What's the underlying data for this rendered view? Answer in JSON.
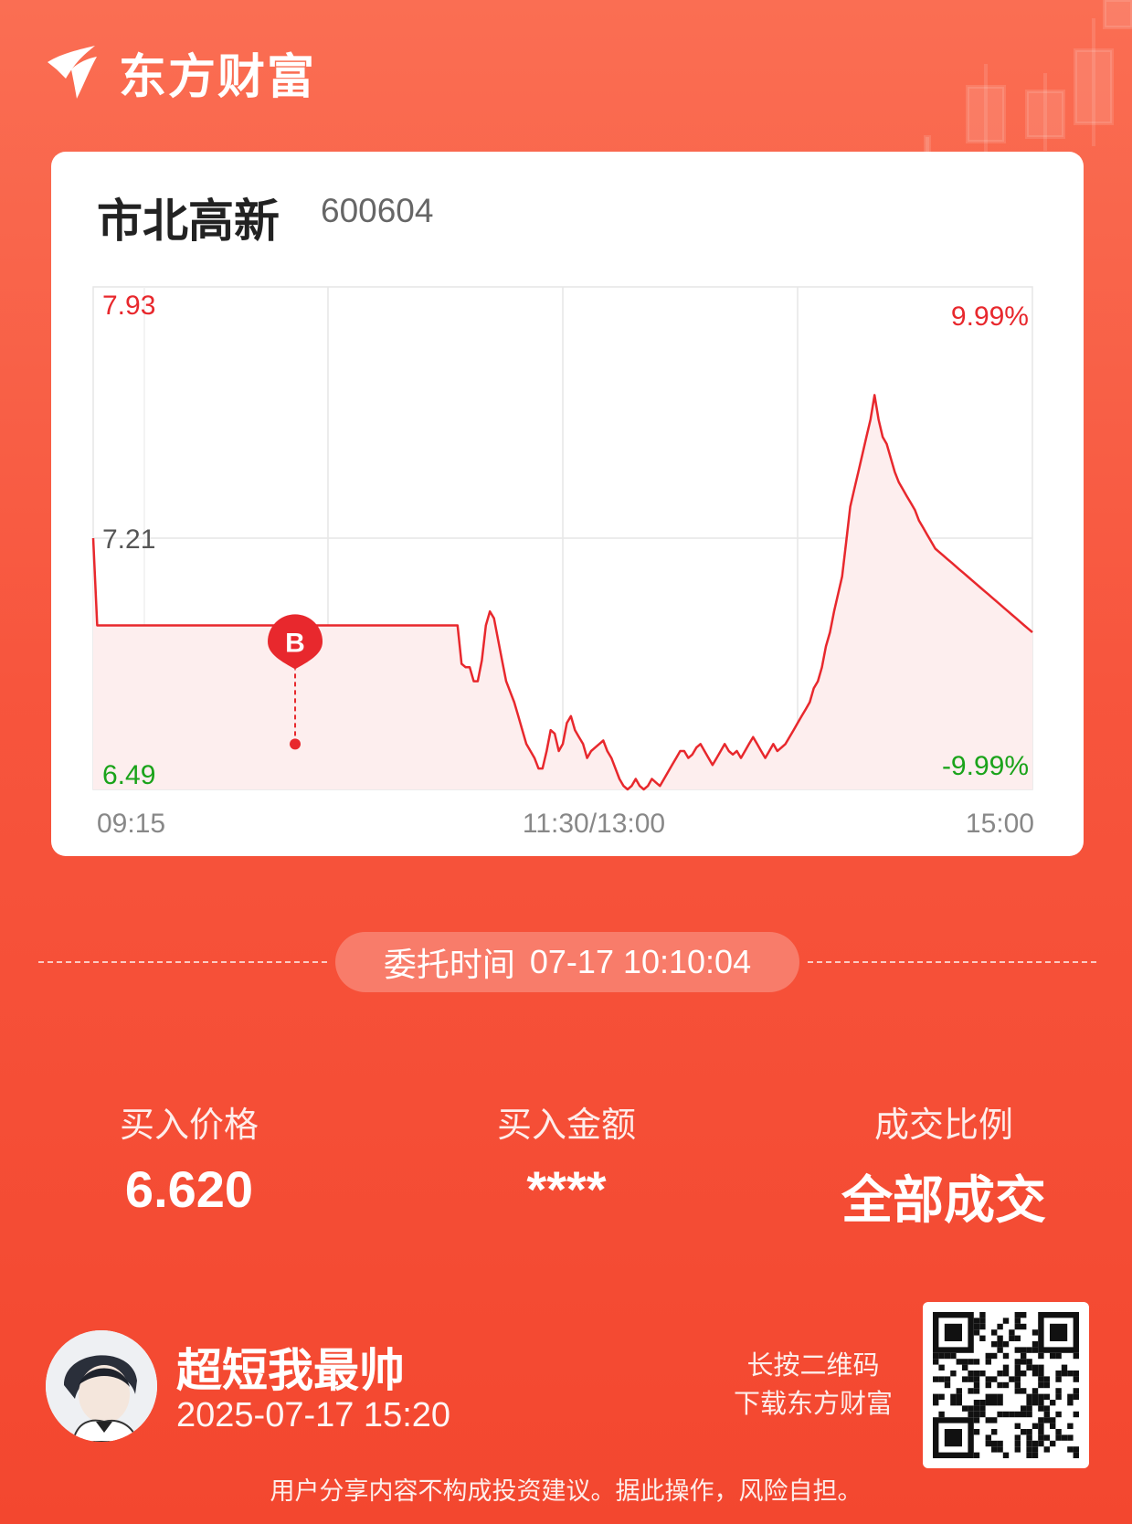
{
  "brand": {
    "name": "东方财富"
  },
  "stock": {
    "name": "市北高新",
    "code": "600604"
  },
  "chart_data": {
    "type": "line",
    "y_axis_left": {
      "max": "7.93",
      "mid": "7.21",
      "min": "6.49"
    },
    "y_axis_right": {
      "max": "9.99%",
      "min": "-9.99%"
    },
    "x_ticks": [
      "09:15",
      "11:30/13:00",
      "15:00"
    ],
    "ylim": [
      6.49,
      7.93
    ],
    "buy_marker": {
      "label": "B",
      "time": "10:10",
      "price": 6.62
    },
    "series": [
      {
        "values": [
          7.21,
          6.96,
          6.96,
          6.96,
          6.96,
          6.96,
          6.96,
          6.96,
          6.96,
          6.96,
          6.96,
          6.96,
          6.96,
          6.96,
          6.96,
          6.96,
          6.96,
          6.96,
          6.96,
          6.96,
          6.96,
          6.96,
          6.96,
          6.96,
          6.96,
          6.96,
          6.96,
          6.96,
          6.96,
          6.96,
          6.96,
          6.96,
          6.96,
          6.96,
          6.96,
          6.96,
          6.96,
          6.96,
          6.96,
          6.96,
          6.96,
          6.96,
          6.96,
          6.96,
          6.96,
          6.96,
          6.96,
          6.96,
          6.96,
          6.96,
          6.96,
          6.96,
          6.96,
          6.96,
          6.96,
          6.96,
          6.96,
          6.96,
          6.96,
          6.96,
          6.96,
          6.96,
          6.96,
          6.96,
          6.96,
          6.96,
          6.96,
          6.96,
          6.96,
          6.96,
          6.96,
          6.96,
          6.96,
          6.96,
          6.96,
          6.96,
          6.96,
          6.96,
          6.96,
          6.96,
          6.96,
          6.96,
          6.96,
          6.96,
          6.96,
          6.96,
          6.96,
          6.96,
          6.96,
          6.96,
          6.96,
          6.85,
          6.84,
          6.84,
          6.8,
          6.8,
          6.86,
          6.96,
          7.0,
          6.98,
          6.92,
          6.86,
          6.8,
          6.77,
          6.74,
          6.7,
          6.66,
          6.62,
          6.6,
          6.58,
          6.55,
          6.55,
          6.6,
          6.66,
          6.65,
          6.6,
          6.62,
          6.68,
          6.7,
          6.66,
          6.64,
          6.62,
          6.58,
          6.6,
          6.61,
          6.62,
          6.63,
          6.6,
          6.58,
          6.55,
          6.52,
          6.5,
          6.49,
          6.5,
          6.52,
          6.5,
          6.49,
          6.5,
          6.52,
          6.51,
          6.5,
          6.52,
          6.54,
          6.56,
          6.58,
          6.6,
          6.6,
          6.58,
          6.59,
          6.61,
          6.62,
          6.6,
          6.58,
          6.56,
          6.58,
          6.6,
          6.62,
          6.6,
          6.59,
          6.6,
          6.58,
          6.6,
          6.62,
          6.64,
          6.62,
          6.6,
          6.58,
          6.6,
          6.62,
          6.6,
          6.61,
          6.62,
          6.64,
          6.66,
          6.68,
          6.7,
          6.72,
          6.74,
          6.78,
          6.8,
          6.84,
          6.9,
          6.94,
          7.0,
          7.05,
          7.1,
          7.2,
          7.3,
          7.35,
          7.4,
          7.45,
          7.5,
          7.55,
          7.62,
          7.55,
          7.5,
          7.48,
          7.44,
          7.4,
          7.37,
          7.35,
          7.33,
          7.31,
          7.29,
          7.26,
          7.24,
          7.22,
          7.2,
          7.18,
          7.17,
          7.16,
          7.15,
          7.14,
          7.13,
          7.12,
          7.11,
          7.1,
          7.09,
          7.08,
          7.07,
          7.06,
          7.05,
          7.04,
          7.03,
          7.02,
          7.01,
          7.0,
          6.99,
          6.98,
          6.97,
          6.96,
          6.95,
          6.94
        ]
      }
    ],
    "grid": true,
    "colors": {
      "line": "#e8282d",
      "up": "#e8282d",
      "down": "#1aa31a",
      "fill": "#fdeeee"
    }
  },
  "order": {
    "label": "委托时间",
    "time": "07-17 10:10:04"
  },
  "stats": [
    {
      "label": "买入价格",
      "value": "6.620"
    },
    {
      "label": "买入金额",
      "value": "****"
    },
    {
      "label": "成交比例",
      "value": "全部成交"
    }
  ],
  "user": {
    "name": "超短我最帅",
    "datetime": "2025-07-17 15:20"
  },
  "qr_hint": {
    "line1": "长按二维码",
    "line2": "下载东方财富"
  },
  "disclaimer": "用户分享内容不构成投资建议。据此操作，风险自担。"
}
